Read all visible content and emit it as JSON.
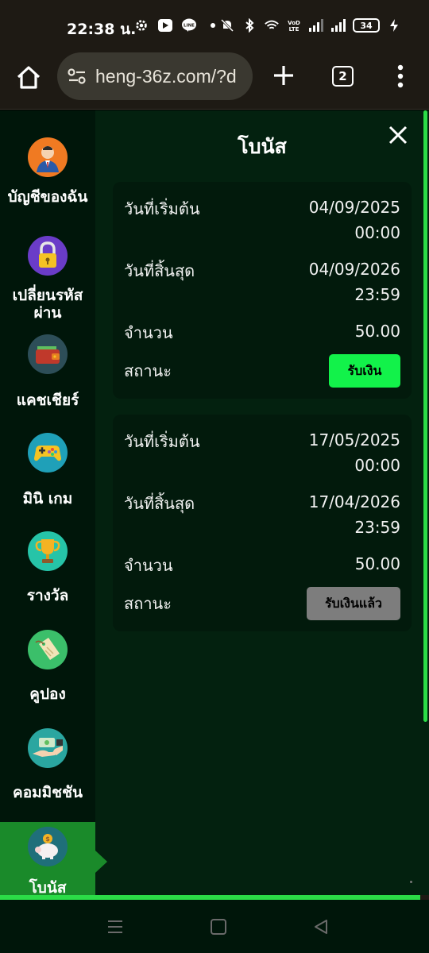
{
  "status_bar": {
    "time": "22:38 น.",
    "battery": "34"
  },
  "browser": {
    "url": "heng-36z.com/?d",
    "tab_count": "2"
  },
  "sidebar": {
    "items": [
      {
        "label": "บัญชีของฉัน",
        "icon": "user-icon"
      },
      {
        "label": "เปลี่ยนรหัสผ่าน",
        "icon": "lock-icon"
      },
      {
        "label": "แคชเชียร์",
        "icon": "wallet-icon"
      },
      {
        "label": "มินิ เกม",
        "icon": "gamepad-icon"
      },
      {
        "label": "รางวัล",
        "icon": "trophy-icon"
      },
      {
        "label": "คูปอง",
        "icon": "coupon-icon"
      },
      {
        "label": "คอมมิชชัน",
        "icon": "commission-icon"
      },
      {
        "label": "โบนัส",
        "icon": "piggy-bank-icon"
      }
    ]
  },
  "panel": {
    "title": "โบนัส"
  },
  "bonuses": [
    {
      "start_label": "วันที่เริ่มต้น",
      "start_date": "04/09/2025",
      "start_time": "00:00",
      "end_label": "วันที่สิ้นสุด",
      "end_date": "04/09/2026",
      "end_time": "23:59",
      "amount_label": "จำนวน",
      "amount": "50.00",
      "status_label": "สถานะ",
      "button": "รับเงิน"
    },
    {
      "start_label": "วันที่เริ่มต้น",
      "start_date": "17/05/2025",
      "start_time": "00:00",
      "end_label": "วันที่สิ้นสุด",
      "end_date": "17/04/2026",
      "end_time": "23:59",
      "amount_label": "จำนวน",
      "amount": "50.00",
      "status_label": "สถานะ",
      "button": "รับเงินแล้ว"
    }
  ],
  "page_load_progress": 0.98,
  "colors": {
    "accent_green": "#12f24a",
    "app_bg": "#03210f",
    "sidebar_active": "#1a8a2a"
  }
}
